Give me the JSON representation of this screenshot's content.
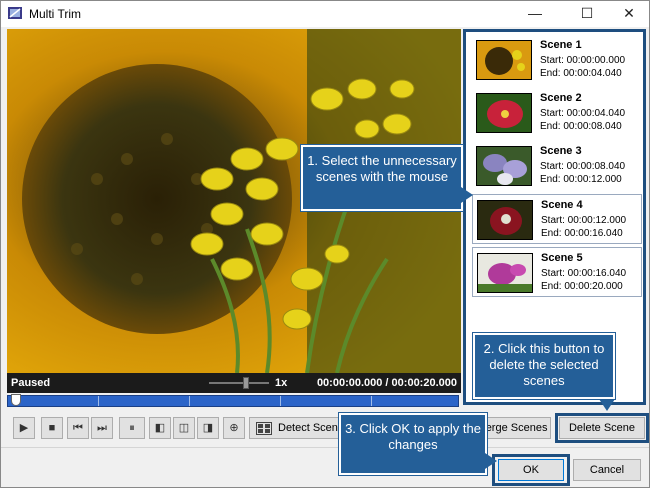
{
  "window": {
    "title": "Multi Trim",
    "minimize_icon": "minimize-icon",
    "maximize_icon": "maximize-icon",
    "close_icon": "close-icon"
  },
  "player": {
    "status": "Paused",
    "speed": "1x",
    "time": "00:00:00.000  / 00:00:20.000",
    "speed_level": 0.6,
    "position": 0.0
  },
  "toolbar": {
    "buttons": [
      {
        "icon": "play-icon",
        "glyph": "▶"
      },
      {
        "icon": "stop-icon",
        "glyph": "■"
      },
      {
        "icon": "previous-frame-icon",
        "glyph": "⏮"
      },
      {
        "icon": "next-frame-icon",
        "glyph": "⏭"
      },
      {
        "icon": "split-scene-icon",
        "glyph": "⏸"
      },
      {
        "icon": "mark-start-icon",
        "glyph": "◧"
      },
      {
        "icon": "mark-middle-icon",
        "glyph": "◫"
      },
      {
        "icon": "mark-end-icon",
        "glyph": "◨"
      },
      {
        "icon": "zoom-icon",
        "glyph": "⊕"
      }
    ],
    "detect_label": "Detect Scenes",
    "merge_label": "Merge Scenes",
    "delete_label": "Delete Scene"
  },
  "footer": {
    "ok_label": "OK",
    "cancel_label": "Cancel"
  },
  "scenes": [
    {
      "name": "Scene 1",
      "start": "Start: 00:00:00.000",
      "end": "End:   00:00:04.040",
      "color": "#8a6a12"
    },
    {
      "name": "Scene 2",
      "start": "Start: 00:00:04.040",
      "end": "End:   00:00:08.040",
      "color": "#c8223a"
    },
    {
      "name": "Scene 3",
      "start": "Start: 00:00:08.040",
      "end": "End:   00:00:12.000",
      "color": "#8a84c0"
    },
    {
      "name": "Scene 4",
      "start": "Start: 00:00:12.000",
      "end": "End:   00:00:16.040",
      "color": "#8a1420"
    },
    {
      "name": "Scene 5",
      "start": "Start: 00:00:16.040",
      "end": "End:   00:00:20.000",
      "color": "#b03a9a"
    }
  ],
  "callouts": {
    "select": "1. Select the unnecessary scenes with the mouse",
    "delete": "2. Click this button to delete the selected scenes",
    "ok": "3. Click OK to apply the changes"
  },
  "colors": {
    "accent": "#245f98",
    "timeline": "#2b64c8"
  }
}
